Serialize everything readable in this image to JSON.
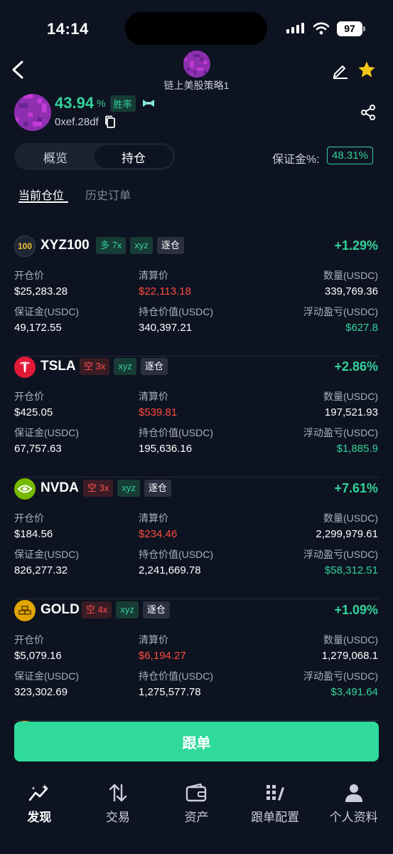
{
  "status_bar": {
    "time": "14:14",
    "battery": "97"
  },
  "header": {
    "strategy_name": "链上美股策略1"
  },
  "profile": {
    "win_rate_value": "43.94",
    "win_rate_pct": "%",
    "win_rate_label": "胜率",
    "address": "0xef.28df"
  },
  "tabs": [
    {
      "label": "概览"
    },
    {
      "label": "持仓",
      "active": true
    }
  ],
  "margin": {
    "label": "保证金%:",
    "value": "48.31%"
  },
  "subtabs": {
    "current": "当前仓位",
    "history": "历史订单"
  },
  "field_labels": {
    "entry_price": "开仓价",
    "liq_price": "清算价",
    "quantity": "数量(USDC)",
    "margin": "保证金(USDC)",
    "position_value": "持仓价值(USDC)",
    "pnl": "浮动盈亏(USDC)"
  },
  "positions": [
    {
      "symbol": "XYZ100",
      "icon_text": "100",
      "icon": "xyz100-icon",
      "side": "多 7x",
      "side_type": "long",
      "dex": "xyz",
      "mode": "逐仓",
      "change": "+1.29%",
      "entry_price": "$25,283.28",
      "liq_price": "$22,113.18",
      "quantity": "339,769.36",
      "margin": "49,172.55",
      "position_value": "340,397.21",
      "pnl": "$627.8"
    },
    {
      "symbol": "TSLA",
      "icon_text": "",
      "icon": "tesla-logo-icon",
      "side": "空 3x",
      "side_type": "short",
      "dex": "xyz",
      "mode": "逐仓",
      "change": "+2.86%",
      "entry_price": "$425.05",
      "liq_price": "$539.81",
      "quantity": "197,521.93",
      "margin": "67,757.63",
      "position_value": "195,636.16",
      "pnl": "$1,885.9"
    },
    {
      "symbol": "NVDA",
      "icon_text": "",
      "icon": "nvidia-logo-icon",
      "side": "空 3x",
      "side_type": "short",
      "dex": "xyz",
      "mode": "逐仓",
      "change": "+7.61%",
      "entry_price": "$184.56",
      "liq_price": "$234.46",
      "quantity": "2,299,979.61",
      "margin": "826,277.32",
      "position_value": "2,241,669.78",
      "pnl": "$58,312.51"
    },
    {
      "symbol": "GOLD",
      "icon_text": "",
      "icon": "gold-bars-icon",
      "side": "空 4x",
      "side_type": "short",
      "dex": "xyz",
      "mode": "逐仓",
      "change": "+1.09%",
      "entry_price": "$5,079.16",
      "liq_price": "$6,194.27",
      "quantity": "1,279,068.1",
      "margin": "323,302.69",
      "position_value": "1,275,577.78",
      "pnl": "$3,491.64"
    }
  ],
  "follow_button": "跟单",
  "nav": [
    {
      "label": "发现",
      "icon": "discover-icon",
      "active": true
    },
    {
      "label": "交易",
      "icon": "trade-icon"
    },
    {
      "label": "资产",
      "icon": "wallet-icon"
    },
    {
      "label": "跟单配置",
      "icon": "copy-config-icon"
    },
    {
      "label": "个人资料",
      "icon": "profile-icon"
    }
  ],
  "colors": {
    "accent": "#31d39a",
    "danger": "#ff4d3d",
    "background": "#0e1321",
    "button": "#2fda9c"
  }
}
